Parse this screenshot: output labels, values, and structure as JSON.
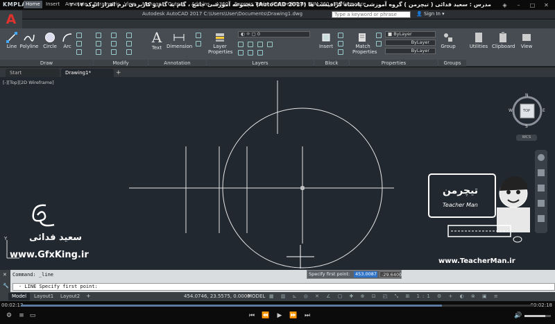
{
  "player": {
    "logo": "KMPLAYER",
    "title": "مجموعه آموزشی جامع ، گام به گام و کاربردی نرم افزار اتوکد ۲۰۱۷ (AutoCAD 2017) مدرس : سعید فدائی ( تیچرمن ) گروه آموزشی پادشاه گرافیست ها",
    "time_current": "00:02:13",
    "time_total": "00:02:18",
    "progress": 0.82
  },
  "app": {
    "icon_letter": "A",
    "title": "Autodesk AutoCAD 2017   C:\\Users\\User\\Documents\\Drawing1.dwg",
    "search_placeholder": "Type a keyword or phrase",
    "sign_in": "Sign In"
  },
  "ribbon_tabs": [
    "Home",
    "Insert",
    "Annotate",
    "Parametric",
    "View",
    "Manage",
    "Output",
    "Add-ins",
    "A360",
    "Express Tools",
    "Featured Apps",
    "BIM 360",
    "Performance"
  ],
  "ribbon": {
    "draw": [
      "Line",
      "Polyline",
      "Circle",
      "Arc"
    ],
    "text_btn": "Text",
    "dimension_btn": "Dimension",
    "layer_props": "Layer Properties",
    "insert_btn": "Insert",
    "match_props": "Match Properties",
    "group_btn": "Group",
    "utilities_btn": "Utilities",
    "clipboard_btn": "Clipboard",
    "view_btn": "View",
    "panels": [
      "Draw",
      "Modify",
      "Annotation",
      "Layers",
      "Block",
      "Properties",
      "Groups"
    ],
    "layer_value": "0",
    "bylayer": [
      "ByLayer",
      "ByLayer",
      "ByLayer"
    ]
  },
  "doc_tabs": [
    "Start",
    "Drawing1*"
  ],
  "viewport_label": "[-][Top][2D Wireframe]",
  "viewcube": {
    "n": "N",
    "s": "S",
    "e": "E",
    "w": "W",
    "top": "TOP",
    "wcs": "WCS"
  },
  "overlay": {
    "author_fa": "سعید فدائی",
    "site1": "www.GfxKing.ir",
    "site2": "www.TeacherMan.ir",
    "logo_text": "تیچرمن",
    "logo_sub": "Teacher Man"
  },
  "command": {
    "history": "Command: _line",
    "current": "- LINE Specify first point:",
    "dyn_label": "Specify first point:",
    "dyn_x": "453.0087",
    "dyn_y": "-29.6400"
  },
  "layout_tabs": [
    "Model",
    "Layout1",
    "Layout2"
  ],
  "status": {
    "coords": "454.0746, 23.5575, 0.0000",
    "model": "MODEL"
  }
}
